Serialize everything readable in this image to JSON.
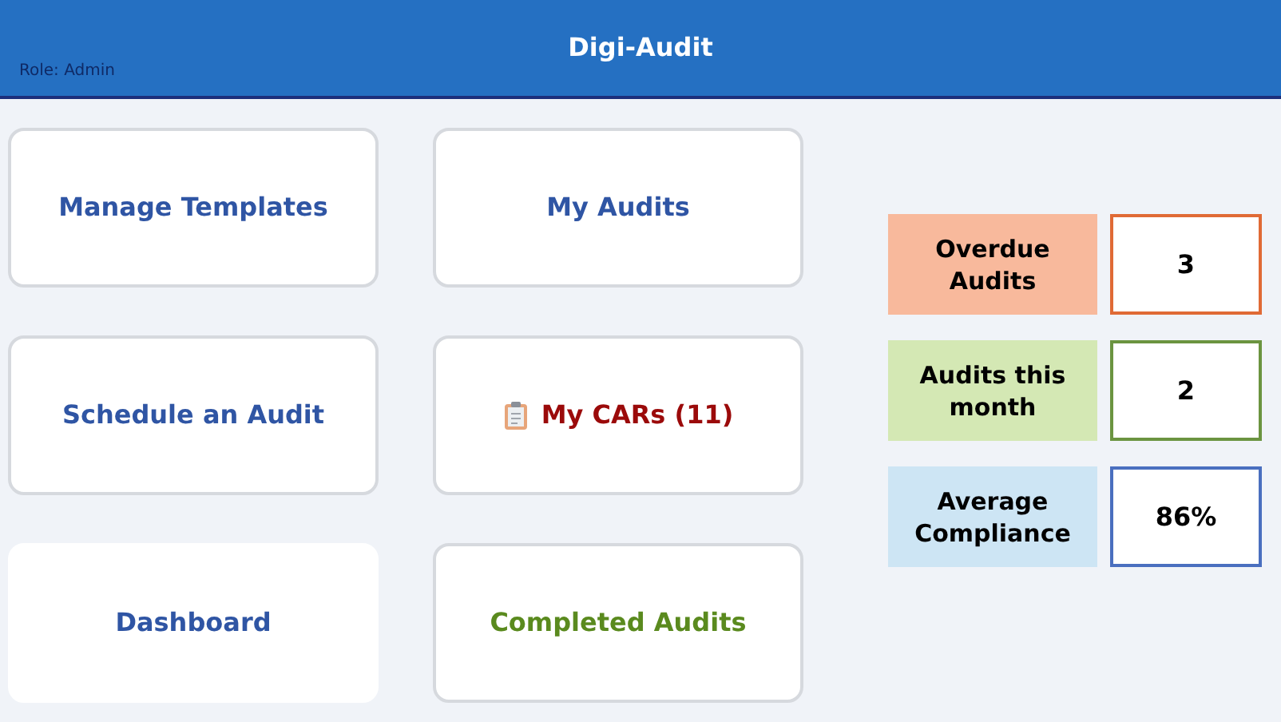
{
  "header": {
    "title": "Digi-Audit",
    "role": "Role: Admin"
  },
  "tiles": [
    {
      "label": "Manage Templates",
      "color": "#2f55a4",
      "kind": "plain",
      "bordered": true
    },
    {
      "label": "My Audits",
      "color": "#2f55a4",
      "kind": "plain",
      "bordered": true
    },
    {
      "label": "Schedule an Audit",
      "color": "#2f55a4",
      "kind": "plain",
      "bordered": true
    },
    {
      "label": "My CARs (11)",
      "color": "#9b0a0a",
      "kind": "clipboard",
      "bordered": true
    },
    {
      "label": "Dashboard",
      "color": "#2f55a4",
      "kind": "plain",
      "bordered": false
    },
    {
      "label": "Completed Audits",
      "color": "#5a8a1e",
      "kind": "plain",
      "bordered": true
    }
  ],
  "stats": [
    {
      "label": "Overdue Audits",
      "value": "3",
      "kind": "orange"
    },
    {
      "label": "Audits this month",
      "value": "2",
      "kind": "green"
    },
    {
      "label": "Average Compliance",
      "value": "86%",
      "kind": "blue"
    }
  ]
}
